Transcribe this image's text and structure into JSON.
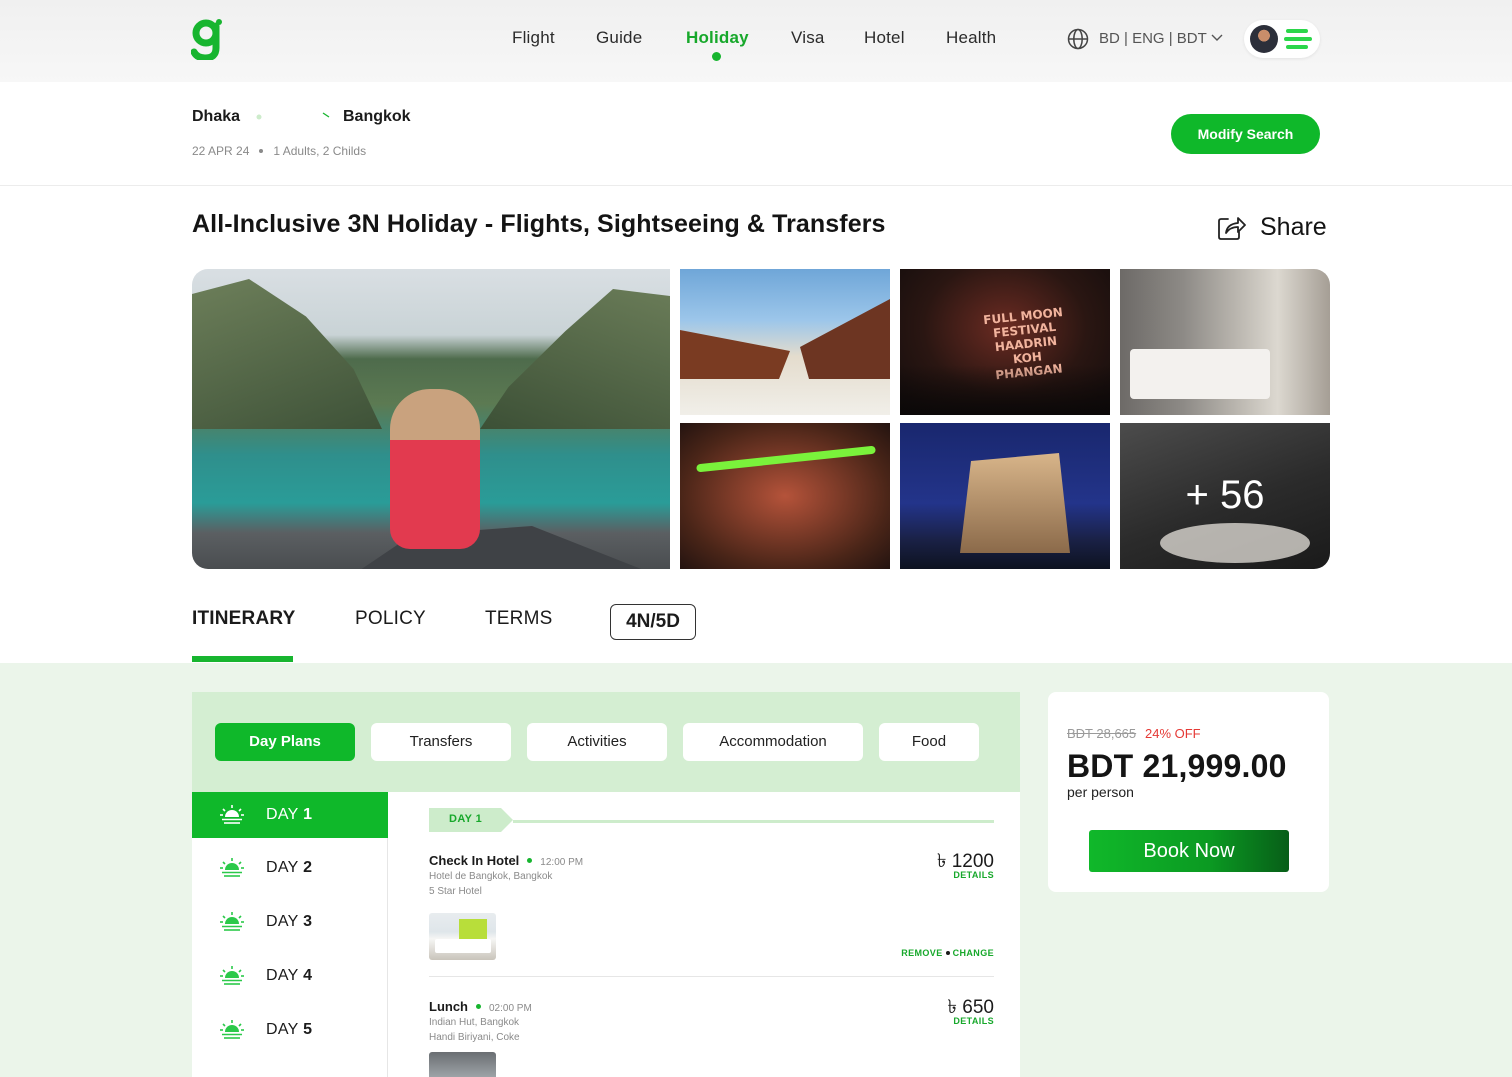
{
  "nav": {
    "logo": "g",
    "items": [
      {
        "label": "Flight",
        "active": false
      },
      {
        "label": "Guide",
        "active": false
      },
      {
        "label": "Holiday",
        "active": true
      },
      {
        "label": "Visa",
        "active": false
      },
      {
        "label": "Hotel",
        "active": false
      },
      {
        "label": "Health",
        "active": false
      }
    ],
    "locale": "BD | ENG | BDT",
    "icons": {
      "globe": "globe-icon",
      "chevron": "chevron-down-icon",
      "menu": "menu-icon"
    },
    "accent_color": "#17b52f"
  },
  "search": {
    "from": "Dhaka",
    "to": "Bangkok",
    "date": "22 APR 24",
    "travellers": "1 Adults, 2 Childs",
    "modify_label": "Modify Search"
  },
  "package": {
    "title": "All-Inclusive 3N Holiday - Flights, Sightseeing & Transfers",
    "share_label": "Share"
  },
  "gallery": {
    "more_count": "+ 56",
    "neon_text": "FULL MOON FESTIVAL HAADRIN KOH PHANGAN"
  },
  "tabs": {
    "items": [
      "ITINERARY",
      "POLICY",
      "TERMS"
    ],
    "active": "ITINERARY",
    "duration": "4N/5D"
  },
  "filters": {
    "items": [
      "Day Plans",
      "Transfers",
      "Activities",
      "Accommodation",
      "Food"
    ],
    "active": "Day Plans"
  },
  "days": {
    "prefix": "DAY",
    "items": [
      {
        "num": "1",
        "active": true
      },
      {
        "num": "2",
        "active": false
      },
      {
        "num": "3",
        "active": false
      },
      {
        "num": "4",
        "active": false
      },
      {
        "num": "5",
        "active": false
      }
    ]
  },
  "day_content": {
    "tag": "DAY 1",
    "events": [
      {
        "title": "Check In Hotel",
        "time": "12:00 PM",
        "line1": "Hotel de Bangkok, Bangkok",
        "line2": "5 Star Hotel",
        "price": "৳ 1200",
        "details": "DETAILS",
        "remove": "REMOVE",
        "change": "CHANGE"
      },
      {
        "title": "Lunch",
        "time": "02:00 PM",
        "line1": "Indian Hut, Bangkok",
        "line2": "Handi Biriyani, Coke",
        "price": "৳ 650",
        "details": "DETAILS"
      }
    ]
  },
  "pricing": {
    "old_price": "BDT 28,665",
    "discount": "24% OFF",
    "final_price": "BDT 21,999.00",
    "per": "per person",
    "book_label": "Book Now",
    "discount_color": "#e53935"
  }
}
